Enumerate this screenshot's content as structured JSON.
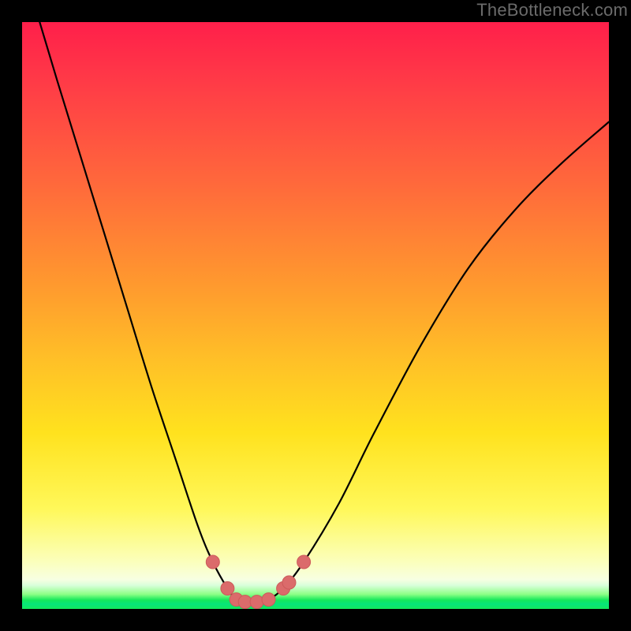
{
  "watermark": "TheBottleneck.com",
  "colors": {
    "bg_black": "#000000",
    "dot": "#db6b6b",
    "curve": "#000000"
  },
  "chart_data": {
    "type": "line",
    "title": "",
    "xlabel": "",
    "ylabel": "",
    "xlim": [
      0,
      100
    ],
    "ylim": [
      0,
      100
    ],
    "grid": false,
    "legend": false,
    "series": [
      {
        "name": "bottleneck-curve",
        "x": [
          3,
          6,
          10,
          14,
          18,
          22,
          26,
          30,
          32.5,
          35,
          36.5,
          38,
          40,
          42,
          44.5,
          48,
          54,
          60,
          68,
          76,
          84,
          92,
          100
        ],
        "y": [
          100,
          90,
          77,
          64,
          51,
          38,
          26,
          14,
          8,
          3.5,
          1.6,
          1.2,
          1.2,
          1.6,
          3.5,
          8,
          18,
          30,
          45,
          58,
          68,
          76,
          83
        ]
      }
    ],
    "markers": [
      {
        "x": 32.5,
        "y": 8.0
      },
      {
        "x": 35.0,
        "y": 3.5
      },
      {
        "x": 36.5,
        "y": 1.6
      },
      {
        "x": 38.0,
        "y": 1.2
      },
      {
        "x": 40.0,
        "y": 1.2
      },
      {
        "x": 42.0,
        "y": 1.6
      },
      {
        "x": 44.5,
        "y": 3.5
      },
      {
        "x": 45.5,
        "y": 4.5
      },
      {
        "x": 48.0,
        "y": 8.0
      }
    ],
    "note": "Axes are unlabeled in the source image; x and y are normalized 0–100 from pixel positions. The curve descends steeply from top-left, reaches a narrow minimum near x≈39, then rises more gently toward the right edge."
  }
}
